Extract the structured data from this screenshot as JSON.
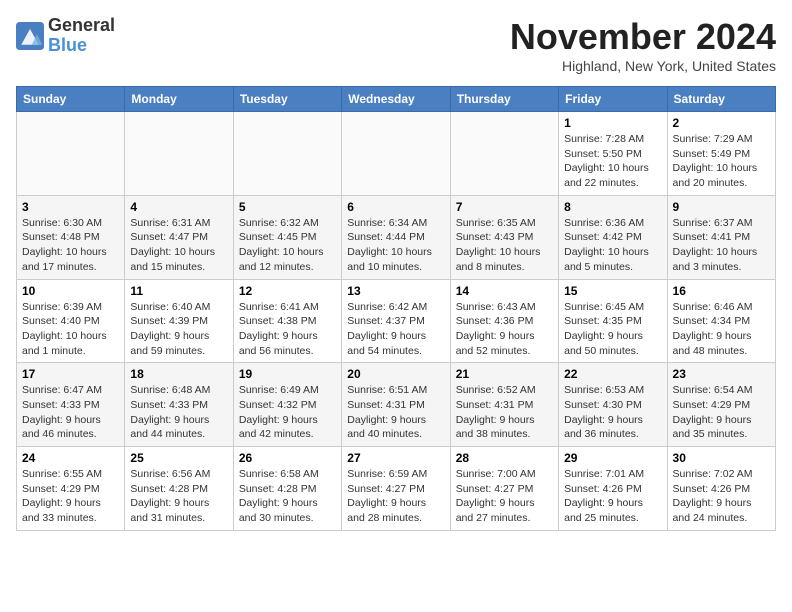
{
  "logo": {
    "line1": "General",
    "line2": "Blue"
  },
  "title": "November 2024",
  "location": "Highland, New York, United States",
  "days_of_week": [
    "Sunday",
    "Monday",
    "Tuesday",
    "Wednesday",
    "Thursday",
    "Friday",
    "Saturday"
  ],
  "weeks": [
    [
      {
        "num": "",
        "info": ""
      },
      {
        "num": "",
        "info": ""
      },
      {
        "num": "",
        "info": ""
      },
      {
        "num": "",
        "info": ""
      },
      {
        "num": "",
        "info": ""
      },
      {
        "num": "1",
        "info": "Sunrise: 7:28 AM\nSunset: 5:50 PM\nDaylight: 10 hours and 22 minutes."
      },
      {
        "num": "2",
        "info": "Sunrise: 7:29 AM\nSunset: 5:49 PM\nDaylight: 10 hours and 20 minutes."
      }
    ],
    [
      {
        "num": "3",
        "info": "Sunrise: 6:30 AM\nSunset: 4:48 PM\nDaylight: 10 hours and 17 minutes."
      },
      {
        "num": "4",
        "info": "Sunrise: 6:31 AM\nSunset: 4:47 PM\nDaylight: 10 hours and 15 minutes."
      },
      {
        "num": "5",
        "info": "Sunrise: 6:32 AM\nSunset: 4:45 PM\nDaylight: 10 hours and 12 minutes."
      },
      {
        "num": "6",
        "info": "Sunrise: 6:34 AM\nSunset: 4:44 PM\nDaylight: 10 hours and 10 minutes."
      },
      {
        "num": "7",
        "info": "Sunrise: 6:35 AM\nSunset: 4:43 PM\nDaylight: 10 hours and 8 minutes."
      },
      {
        "num": "8",
        "info": "Sunrise: 6:36 AM\nSunset: 4:42 PM\nDaylight: 10 hours and 5 minutes."
      },
      {
        "num": "9",
        "info": "Sunrise: 6:37 AM\nSunset: 4:41 PM\nDaylight: 10 hours and 3 minutes."
      }
    ],
    [
      {
        "num": "10",
        "info": "Sunrise: 6:39 AM\nSunset: 4:40 PM\nDaylight: 10 hours and 1 minute."
      },
      {
        "num": "11",
        "info": "Sunrise: 6:40 AM\nSunset: 4:39 PM\nDaylight: 9 hours and 59 minutes."
      },
      {
        "num": "12",
        "info": "Sunrise: 6:41 AM\nSunset: 4:38 PM\nDaylight: 9 hours and 56 minutes."
      },
      {
        "num": "13",
        "info": "Sunrise: 6:42 AM\nSunset: 4:37 PM\nDaylight: 9 hours and 54 minutes."
      },
      {
        "num": "14",
        "info": "Sunrise: 6:43 AM\nSunset: 4:36 PM\nDaylight: 9 hours and 52 minutes."
      },
      {
        "num": "15",
        "info": "Sunrise: 6:45 AM\nSunset: 4:35 PM\nDaylight: 9 hours and 50 minutes."
      },
      {
        "num": "16",
        "info": "Sunrise: 6:46 AM\nSunset: 4:34 PM\nDaylight: 9 hours and 48 minutes."
      }
    ],
    [
      {
        "num": "17",
        "info": "Sunrise: 6:47 AM\nSunset: 4:33 PM\nDaylight: 9 hours and 46 minutes."
      },
      {
        "num": "18",
        "info": "Sunrise: 6:48 AM\nSunset: 4:33 PM\nDaylight: 9 hours and 44 minutes."
      },
      {
        "num": "19",
        "info": "Sunrise: 6:49 AM\nSunset: 4:32 PM\nDaylight: 9 hours and 42 minutes."
      },
      {
        "num": "20",
        "info": "Sunrise: 6:51 AM\nSunset: 4:31 PM\nDaylight: 9 hours and 40 minutes."
      },
      {
        "num": "21",
        "info": "Sunrise: 6:52 AM\nSunset: 4:31 PM\nDaylight: 9 hours and 38 minutes."
      },
      {
        "num": "22",
        "info": "Sunrise: 6:53 AM\nSunset: 4:30 PM\nDaylight: 9 hours and 36 minutes."
      },
      {
        "num": "23",
        "info": "Sunrise: 6:54 AM\nSunset: 4:29 PM\nDaylight: 9 hours and 35 minutes."
      }
    ],
    [
      {
        "num": "24",
        "info": "Sunrise: 6:55 AM\nSunset: 4:29 PM\nDaylight: 9 hours and 33 minutes."
      },
      {
        "num": "25",
        "info": "Sunrise: 6:56 AM\nSunset: 4:28 PM\nDaylight: 9 hours and 31 minutes."
      },
      {
        "num": "26",
        "info": "Sunrise: 6:58 AM\nSunset: 4:28 PM\nDaylight: 9 hours and 30 minutes."
      },
      {
        "num": "27",
        "info": "Sunrise: 6:59 AM\nSunset: 4:27 PM\nDaylight: 9 hours and 28 minutes."
      },
      {
        "num": "28",
        "info": "Sunrise: 7:00 AM\nSunset: 4:27 PM\nDaylight: 9 hours and 27 minutes."
      },
      {
        "num": "29",
        "info": "Sunrise: 7:01 AM\nSunset: 4:26 PM\nDaylight: 9 hours and 25 minutes."
      },
      {
        "num": "30",
        "info": "Sunrise: 7:02 AM\nSunset: 4:26 PM\nDaylight: 9 hours and 24 minutes."
      }
    ]
  ]
}
